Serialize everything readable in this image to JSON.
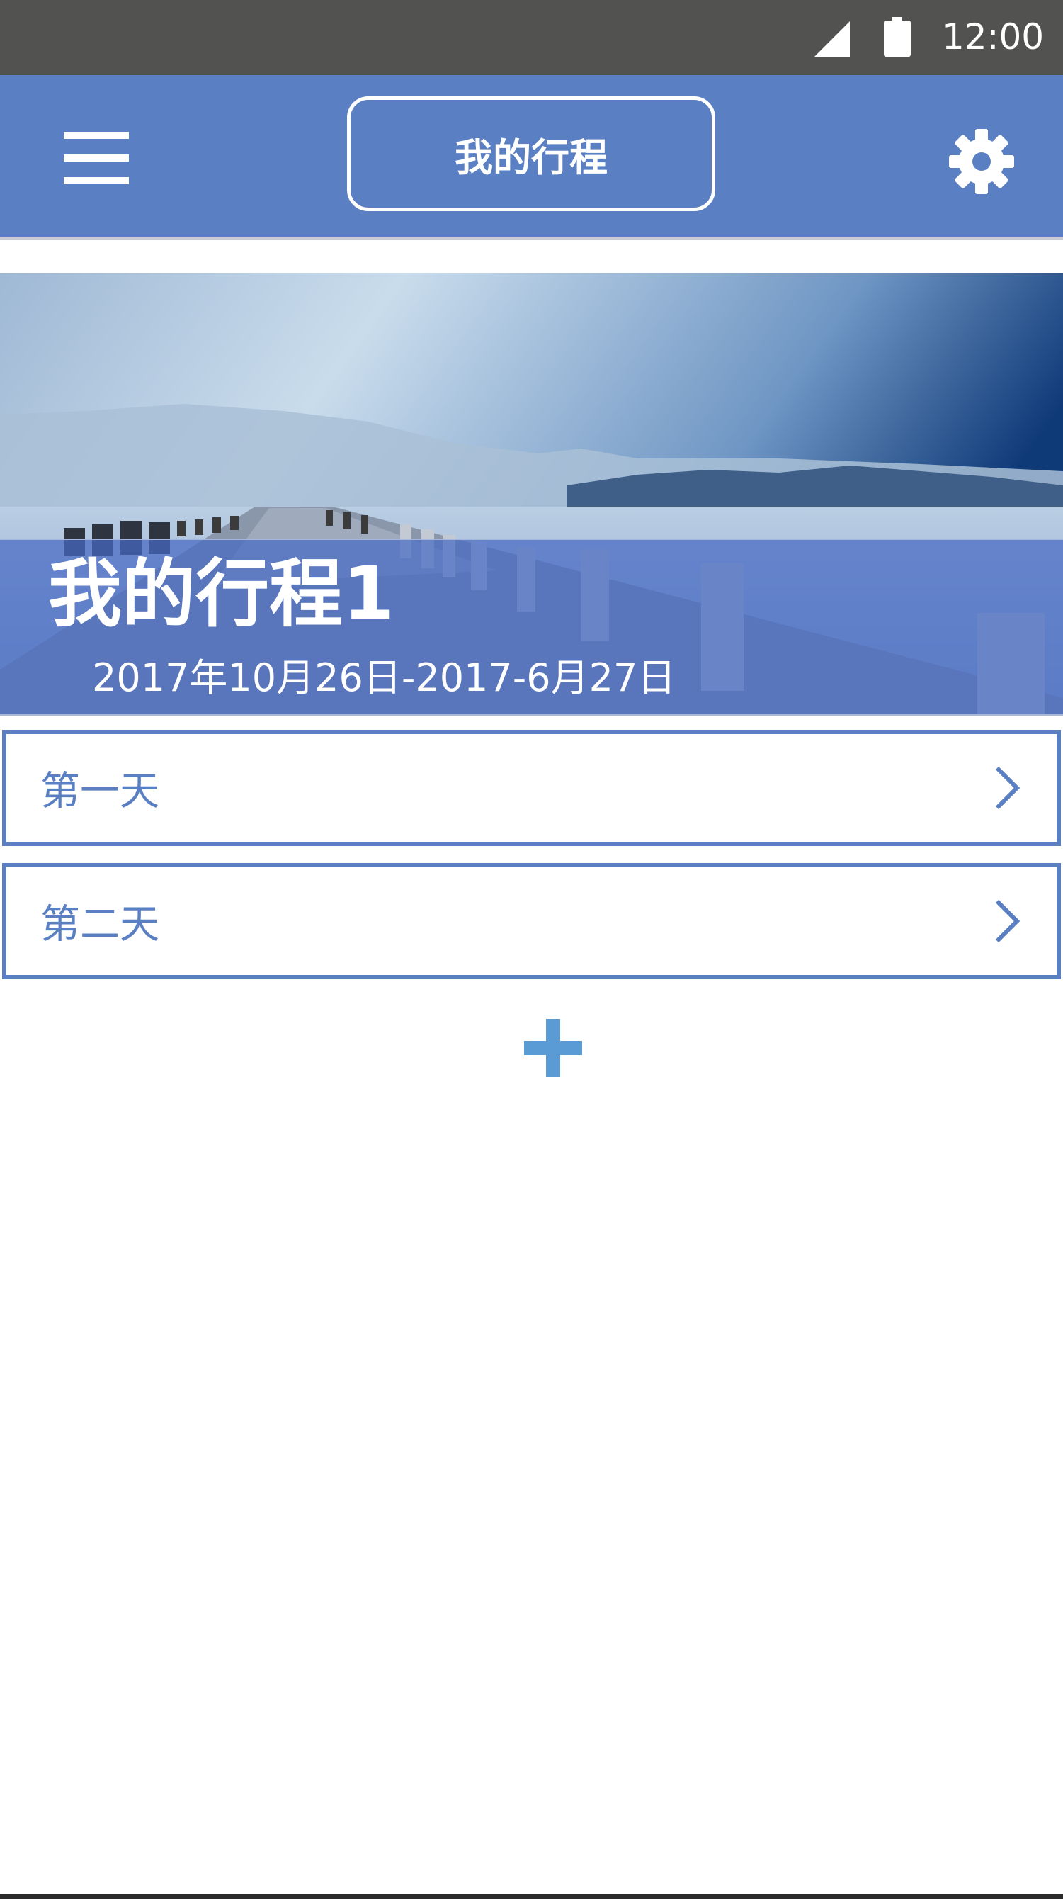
{
  "status_bar": {
    "time": "12:00",
    "icons": [
      "signal-icon",
      "battery-icon"
    ]
  },
  "app_bar": {
    "title": "我的行程",
    "left_icon": "menu-icon",
    "right_icon": "gear-icon"
  },
  "trip": {
    "title": "我的行程1",
    "dates": "2017年10月26日-2017-6月27日"
  },
  "days": [
    {
      "label": "第一天",
      "icon": "chevron-right-icon"
    },
    {
      "label": "第二天",
      "icon": "chevron-right-icon"
    }
  ],
  "add_button_icon": "plus-icon",
  "colors": {
    "status_bar": "#525351",
    "app_bar": "#5a7fc2",
    "accent": "#5a7fc2",
    "add_button": "#5b9bd5",
    "text_on_accent": "#ffffff"
  }
}
